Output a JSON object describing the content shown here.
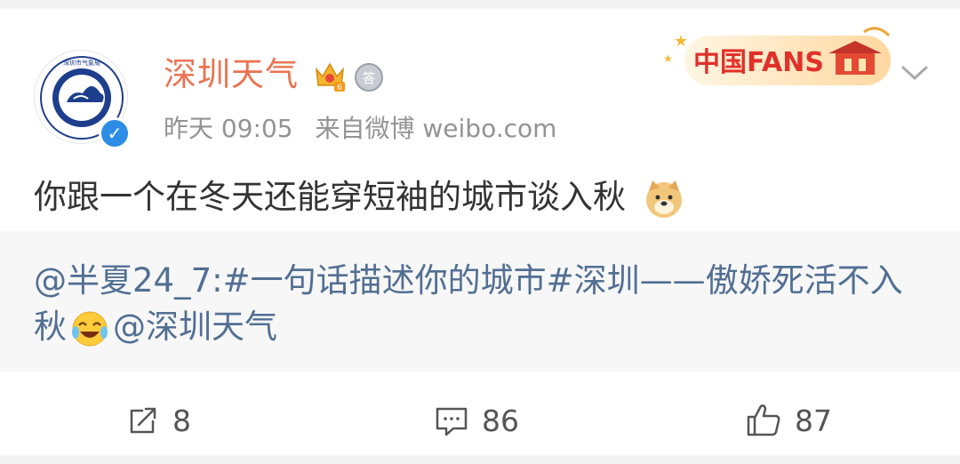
{
  "post": {
    "username": "深圳天气",
    "time": "昨天 09:05",
    "source": "来自微博 weibo.com",
    "text": "你跟一个在冬天还能穿短袖的城市谈入秋",
    "banner_text": "中国FANS"
  },
  "repost": {
    "part1": "@半夏24_7:#一句话描述你的城市#深圳——傲娇死活不入秋",
    "part2": "@深圳天气"
  },
  "actions": {
    "share_count": "8",
    "comment_count": "86",
    "like_count": "87"
  },
  "colors": {
    "username": "#eb7350",
    "link": "#526f93",
    "verified": "#2d8ce6"
  }
}
